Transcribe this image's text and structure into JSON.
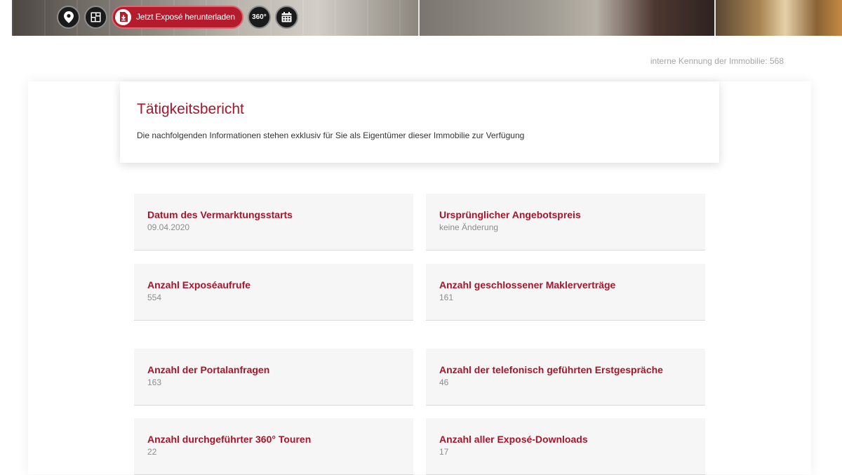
{
  "toolbar": {
    "location_icon": "map-pin-icon",
    "floorplan_icon": "floorplan-icon",
    "download_icon": "file-download-icon",
    "download_label": "Jetzt Exposé herunterladen",
    "tour_label": "360°",
    "calendar_icon": "calendar-icon"
  },
  "property": {
    "id_text": "interne Kennung der Immobilie: 568"
  },
  "report": {
    "title": "Tätigkeitsbericht",
    "description": "Die nachfolgenden Informationen stehen exklusiv für Sie als Eigentümer dieser Immobilie zur Verfügung"
  },
  "stats": [
    {
      "label": "Datum des Vermarktungsstarts",
      "value": "09.04.2020"
    },
    {
      "label": "Ursprünglicher Angebotspreis",
      "value": "keine Änderung"
    },
    {
      "label": "Anzahl Exposéaufrufe",
      "value": "554"
    },
    {
      "label": "Anzahl geschlossener Maklerverträge",
      "value": "161"
    },
    {
      "label": "Anzahl der Portalanfragen",
      "value": "163"
    },
    {
      "label": "Anzahl der telefonisch geführten Erstgespräche",
      "value": "46"
    },
    {
      "label": "Anzahl durchgeführter 360° Touren",
      "value": "22"
    },
    {
      "label": "Anzahl aller Exposé-Downloads",
      "value": "17"
    }
  ],
  "colors": {
    "accent": "#a5162b",
    "button_red": "#b41b2d",
    "muted_text": "#8c8c8c",
    "card_bg": "#f6f6f6"
  }
}
